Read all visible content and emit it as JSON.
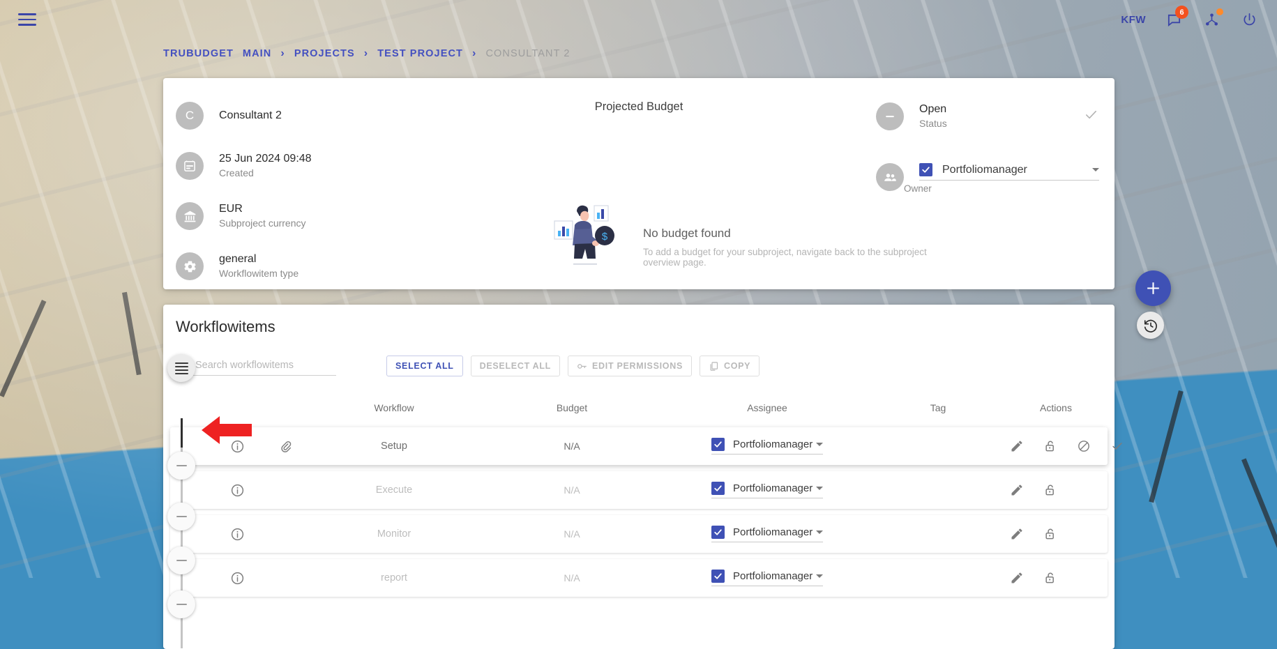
{
  "topbar": {
    "menu_icon": "hamburger-menu-icon",
    "org_label": "KFW",
    "notifications_icon": "chat-bubble-icon",
    "notifications_count": "6",
    "network_icon": "network-share-icon",
    "logout_icon": "power-icon"
  },
  "breadcrumb": {
    "items": [
      {
        "label": "TRUBUDGET",
        "current": false
      },
      {
        "label": "MAIN",
        "current": false
      },
      {
        "label": "PROJECTS",
        "current": false
      },
      {
        "label": "TEST PROJECT",
        "current": false
      },
      {
        "label": "CONSULTANT 2",
        "current": true
      }
    ],
    "separator": "›"
  },
  "detail_card": {
    "left_items": [
      {
        "icon": "avatar-letter",
        "avatar_letter": "C",
        "primary": "Consultant 2",
        "secondary": ""
      },
      {
        "icon": "calendar-icon",
        "primary": "25 Jun 2024 09:48",
        "secondary": "Created"
      },
      {
        "icon": "bank-icon",
        "primary": "EUR",
        "secondary": "Subproject currency"
      },
      {
        "icon": "gear-icon",
        "primary": "general",
        "secondary": "Workflowitem type"
      }
    ],
    "budget_title": "Projected Budget",
    "empty_budget": {
      "heading": "No budget found",
      "subtext": "To add a budget for your subproject, navigate back to the subproject overview page."
    },
    "status": {
      "icon": "minus-circle-icon",
      "value": "Open",
      "label": "Status",
      "confirm_icon": "check-icon"
    },
    "owner": {
      "icon": "people-icon",
      "name": "Portfoliomanager",
      "label": "Owner",
      "checked": true
    }
  },
  "workflowitems": {
    "title": "Workflowitems",
    "search": {
      "placeholder": "Search workflowitems",
      "value": "",
      "icon": "search-icon"
    },
    "toolbar_buttons": [
      {
        "label": "SELECT ALL",
        "icon": "",
        "enabled": true
      },
      {
        "label": "DESELECT ALL",
        "icon": "",
        "enabled": false
      },
      {
        "label": "EDIT PERMISSIONS",
        "icon": "key-icon",
        "enabled": false
      },
      {
        "label": "COPY",
        "icon": "copy-icon",
        "enabled": false
      }
    ],
    "columns": [
      "Workflow",
      "Budget",
      "Assignee",
      "Tag",
      "Actions"
    ],
    "rows": [
      {
        "info_icon": "info-icon",
        "attachment_icon": "attachment-icon",
        "name": "Setup",
        "budget": "N/A",
        "assignee": "Portfoliomanager",
        "assignee_checked": true,
        "tag": "",
        "actions": [
          "edit-pencil-icon",
          "unlock-icon",
          "block-icon",
          "check-icon"
        ],
        "active": true,
        "dim": false
      },
      {
        "info_icon": "info-icon",
        "attachment_icon": "",
        "name": "Execute",
        "budget": "N/A",
        "assignee": "Portfoliomanager",
        "assignee_checked": true,
        "tag": "",
        "actions": [
          "edit-pencil-icon",
          "unlock-icon"
        ],
        "active": false,
        "dim": true
      },
      {
        "info_icon": "info-icon",
        "attachment_icon": "",
        "name": "Monitor",
        "budget": "N/A",
        "assignee": "Portfoliomanager",
        "assignee_checked": true,
        "tag": "",
        "actions": [
          "edit-pencil-icon",
          "unlock-icon"
        ],
        "active": false,
        "dim": true
      },
      {
        "info_icon": "info-icon",
        "attachment_icon": "",
        "name": "report",
        "budget": "N/A",
        "assignee": "Portfoliomanager",
        "assignee_checked": true,
        "tag": "",
        "actions": [
          "edit-pencil-icon",
          "unlock-icon"
        ],
        "active": false,
        "dim": true
      }
    ],
    "drag_handle_icon": "drag-handle-icon",
    "add_button_icon": "plus-icon",
    "history_button_icon": "history-clock-icon"
  },
  "annotation": {
    "arrow_icon": "red-left-arrow",
    "color": "#ee2222"
  },
  "colors": {
    "primary": "#3f51b5",
    "breadcrumb": "#4450c0",
    "badge": "#f4511e",
    "muted": "#b7b7b7"
  }
}
